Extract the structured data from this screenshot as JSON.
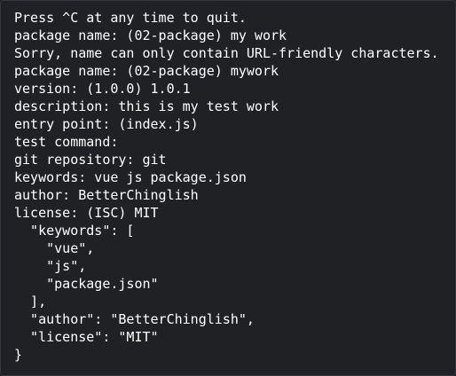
{
  "terminal": {
    "lines": [
      "Press ^C at any time to quit.",
      "package name: (02-package) my work",
      "Sorry, name can only contain URL-friendly characters.",
      "package name: (02-package) mywork",
      "version: (1.0.0) 1.0.1",
      "description: this is my test work",
      "entry point: (index.js)",
      "test command:",
      "git repository: git",
      "keywords: vue js package.json",
      "author: BetterChinglish",
      "license: (ISC) MIT",
      "  \"keywords\": [",
      "    \"vue\",",
      "    \"js\",",
      "    \"package.json\"",
      "  ],",
      "  \"author\": \"BetterChinglish\",",
      "  \"license\": \"MIT\"",
      "}"
    ]
  }
}
